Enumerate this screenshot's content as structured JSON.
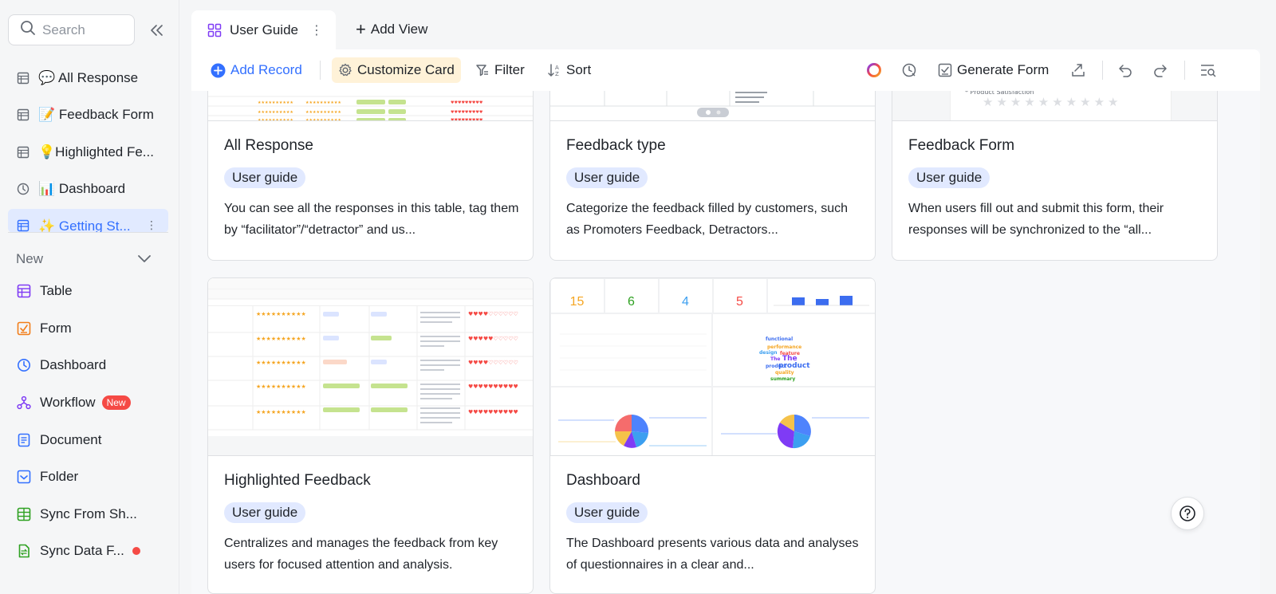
{
  "sidebar": {
    "search_placeholder": "Search",
    "items": [
      {
        "label": "💬 All Response",
        "icon": "table-icon"
      },
      {
        "label": "📝 Feedback Form",
        "icon": "table-icon"
      },
      {
        "label": "💡Highlighted Fe...",
        "icon": "table-icon"
      },
      {
        "label": "📊 Dashboard",
        "icon": "dashboard-icon"
      },
      {
        "label": "✨ Getting St...",
        "icon": "table-icon",
        "active": true
      }
    ],
    "new_label": "New",
    "create": [
      {
        "label": "Table",
        "icon": "table-icon",
        "color": "#7f3bf5"
      },
      {
        "label": "Form",
        "icon": "form-icon",
        "color": "#f27d19"
      },
      {
        "label": "Dashboard",
        "icon": "dashboard-icon",
        "color": "#3370ff"
      },
      {
        "label": "Workflow",
        "icon": "workflow-icon",
        "color": "#7f3bf5",
        "badge": "New"
      },
      {
        "label": "Document",
        "icon": "document-icon",
        "color": "#3370ff"
      },
      {
        "label": "Folder",
        "icon": "folder-icon",
        "color": "#3370ff"
      },
      {
        "label": "Sync From Sh...",
        "icon": "sheet-icon",
        "color": "#2ea121"
      },
      {
        "label": "Sync Data F...",
        "icon": "sync-icon",
        "color": "#2ea121"
      }
    ]
  },
  "tabs": {
    "active": "User Guide",
    "add_view": "Add View"
  },
  "toolbar": {
    "add_record": "Add Record",
    "customize_card": "Customize Card",
    "filter": "Filter",
    "sort": "Sort",
    "generate_form": "Generate Form"
  },
  "cards": [
    {
      "title": "All Response",
      "tag": "User guide",
      "desc": "You can see all the responses in this table, tag them by “facilitator”/“detractor” and us..."
    },
    {
      "title": "Feedback type",
      "tag": "User guide",
      "desc": "Categorize the feedback filled by customers, such as Promoters Feedback, Detractors..."
    },
    {
      "title": "Feedback Form",
      "tag": "User guide",
      "desc": "When users fill out and submit this form, their responses will be synchronized to the “all..."
    },
    {
      "title": "Highlighted Feedback",
      "tag": "User guide",
      "desc": "Centralizes and manages the feedback from key users for focused attention and analysis."
    },
    {
      "title": "Dashboard",
      "tag": "User guide",
      "desc": "The Dashboard presents various data and analyses of questionnaires in a clear and..."
    }
  ],
  "thumb_text": {
    "product_satisfaction": "* Product Satisfaction",
    "stats": [
      "15",
      "6",
      "4",
      "5"
    ],
    "stat_colors": [
      "#f5a623",
      "#2ea121",
      "#3c9ff0",
      "#f54a45"
    ]
  },
  "colors": {
    "accent": "#3370ff",
    "tag_bg": "#e1e9ff",
    "customize_bg": "#fff2d8"
  }
}
